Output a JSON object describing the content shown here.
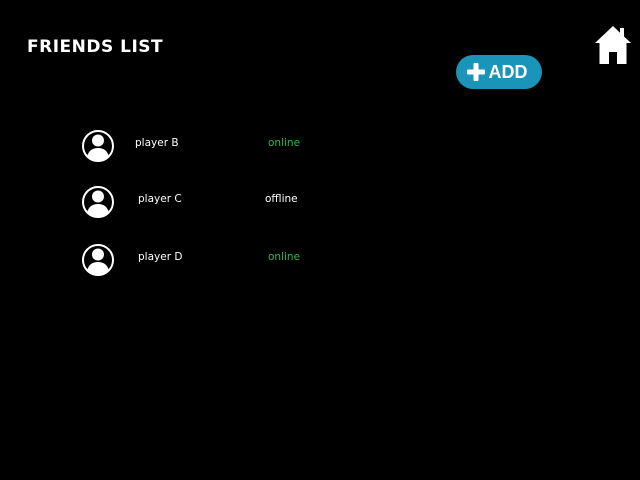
{
  "header": {
    "title": "Friends List",
    "home_icon": "home-icon"
  },
  "add_button": {
    "label": "ADD",
    "icon": "plus-icon",
    "color": "#1a94b8"
  },
  "colors": {
    "online": "#2db84d",
    "offline": "#ffffff"
  },
  "friends": [
    {
      "name": "player B",
      "status": "online",
      "avatar_icon": "avatar-icon"
    },
    {
      "name": "player C",
      "status": "offline",
      "avatar_icon": "avatar-icon"
    },
    {
      "name": "player D",
      "status": "online",
      "avatar_icon": "avatar-icon"
    }
  ]
}
